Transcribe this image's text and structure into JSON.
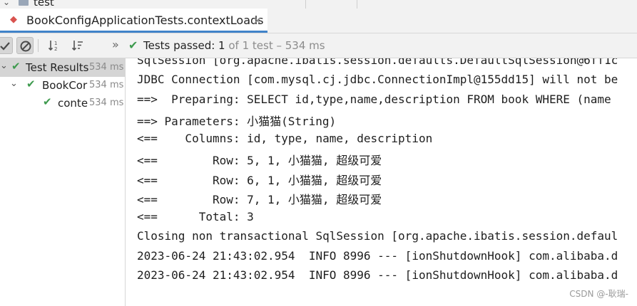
{
  "top_strip": {
    "label": "test"
  },
  "tab": {
    "title": "BookConfigApplicationTests.contextLoads",
    "close_glyph": "×"
  },
  "toolbar": {
    "status_prefix": "Tests passed: ",
    "status_count": "1",
    "status_suffix": " of 1 test – 534 ms",
    "more_glyph": "»"
  },
  "tree": {
    "items": [
      {
        "label": "Test Results",
        "time": "534 ms"
      },
      {
        "label": "BookCor",
        "time": "534 ms"
      },
      {
        "label": "conte",
        "time": "534 ms"
      }
    ]
  },
  "console": {
    "lines": [
      "SqlSession [org.apache.ibatis.session.defaults.DefaultSqlSession@6ff1c",
      "JDBC Connection [com.mysql.cj.jdbc.ConnectionImpl@155dd15] will not be",
      "==>  Preparing: SELECT id,type,name,description FROM book WHERE (name",
      "==> Parameters: 小猫猫(String)",
      "<==    Columns: id, type, name, description",
      "<==        Row: 5, 1, 小猫猫, 超级可爱",
      "<==        Row: 6, 1, 小猫猫, 超级可爱",
      "<==        Row: 7, 1, 小猫猫, 超级可爱",
      "<==      Total: 3",
      "Closing non transactional SqlSession [org.apache.ibatis.session.defaul",
      "2023-06-24 21:43:02.954  INFO 8996 --- [ionShutdownHook] com.alibaba.d",
      "2023-06-24 21:43:02.954  INFO 8996 --- [ionShutdownHook] com.alibaba.d"
    ]
  },
  "watermark": "CSDN @-耿瑞-"
}
